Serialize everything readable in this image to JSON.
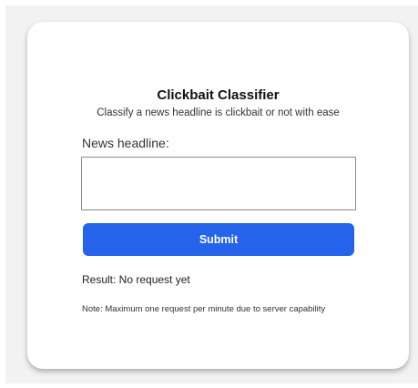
{
  "app": {
    "title": "Clickbait Classifier",
    "subtitle": "Classify a news headline is clickbait or not with ease"
  },
  "form": {
    "headline_label": "News headline:",
    "headline_value": "",
    "submit_label": "Submit"
  },
  "result": {
    "text": "Result: No request yet"
  },
  "note": {
    "text": "Note: Maximum one request per minute due to server capability"
  },
  "colors": {
    "accent": "#2563eb",
    "background": "#f2f2f3",
    "card": "#ffffff"
  }
}
